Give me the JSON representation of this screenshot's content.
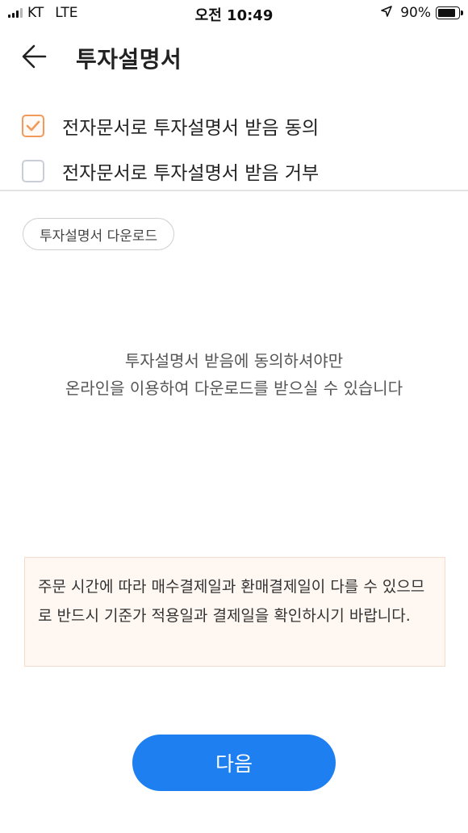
{
  "status_bar": {
    "carrier": "KT",
    "network": "LTE",
    "time": "오전 10:49",
    "battery_percent": "90%",
    "battery_level": 0.9,
    "icons": [
      "signal-icon",
      "location-arrow-icon",
      "battery-icon"
    ]
  },
  "header": {
    "title": "투자설명서",
    "back_icon": "arrow-left-icon"
  },
  "consent": {
    "options": [
      {
        "label": "전자문서로 투자설명서 받음 동의",
        "checked": true
      },
      {
        "label": "전자문서로 투자설명서 받음 거부",
        "checked": false
      }
    ]
  },
  "download": {
    "label": "투자설명서 다운로드"
  },
  "info": {
    "line1": "투자설명서 받음에 동의하셔야만",
    "line2": "온라인을 이용하여 다운로드를 받으실 수 있습니다"
  },
  "notice": {
    "text": "주문 시간에 따라 매수결제일과 환매결제일이 다를 수 있으므로 반드시 기준가 적용일과 결제일을 확인하시기 바랍니다."
  },
  "footer": {
    "next_label": "다음"
  },
  "colors": {
    "accent": "#1e7ff0",
    "check_accent": "#f29a5b",
    "notice_bg": "#fff8f2"
  }
}
